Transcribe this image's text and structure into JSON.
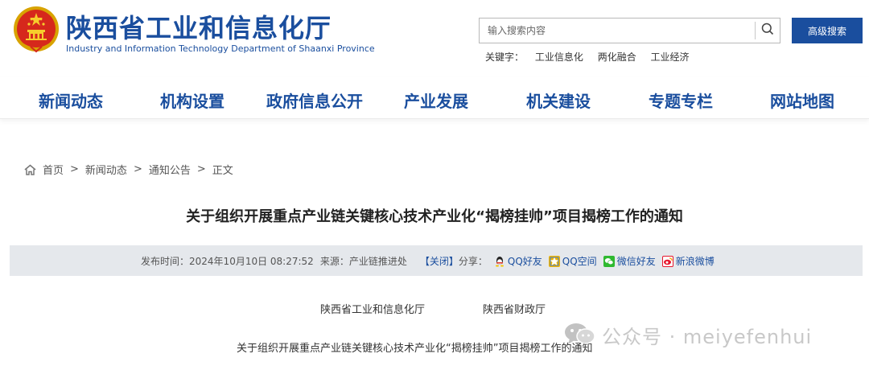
{
  "header": {
    "site_title_cn": "陕西省工业和信息化厅",
    "site_title_en": "Industry and Information Technology Department of Shaanxi Province",
    "search_placeholder": "输入搜索内容",
    "advanced_search_label": "高级搜索",
    "keywords_label": "关键字：",
    "keywords": [
      "工业信息化",
      "两化融合",
      "工业经济"
    ],
    "emblem_icon": "national-emblem-icon",
    "search_icon": "search-icon",
    "accent_color": "#1a4e9e"
  },
  "nav": {
    "items": [
      "新闻动态",
      "机构设置",
      "政府信息公开",
      "产业发展",
      "机关建设",
      "专题专栏",
      "网站地图"
    ]
  },
  "breadcrumb": {
    "home_icon": "home-icon",
    "items": [
      "首页",
      "新闻动态",
      "通知公告",
      "正文"
    ],
    "separator": ">"
  },
  "article": {
    "title": "关于组织开展重点产业链关键核心技术产业化“揭榜挂帅”项目揭榜工作的通知",
    "meta": {
      "publish_label": "发布时间：",
      "publish_time": "2024年10月10日 08:27:52",
      "source_label": "来源：",
      "source": "产业链推进处",
      "close_label": "【关闭】",
      "share_label": "分享：",
      "share_items": [
        {
          "label": "QQ好友",
          "icon": "qq-icon",
          "color": "#f5c400"
        },
        {
          "label": "QQ空间",
          "icon": "qzone-icon",
          "color": "#f2b400"
        },
        {
          "label": "微信好友",
          "icon": "wechat-icon",
          "color": "#2fb930"
        },
        {
          "label": "新浪微博",
          "icon": "weibo-icon",
          "color": "#e6162d"
        }
      ]
    },
    "issuers": [
      "陕西省工业和信息化厅",
      "陕西省财政厅"
    ],
    "subtitle": "关于组织开展重点产业链关键核心技术产业化“揭榜挂帅”项目揭榜工作的通知"
  },
  "watermark": {
    "icon": "wechat-logo-icon",
    "text": "公众号 · meiyefenhui"
  }
}
